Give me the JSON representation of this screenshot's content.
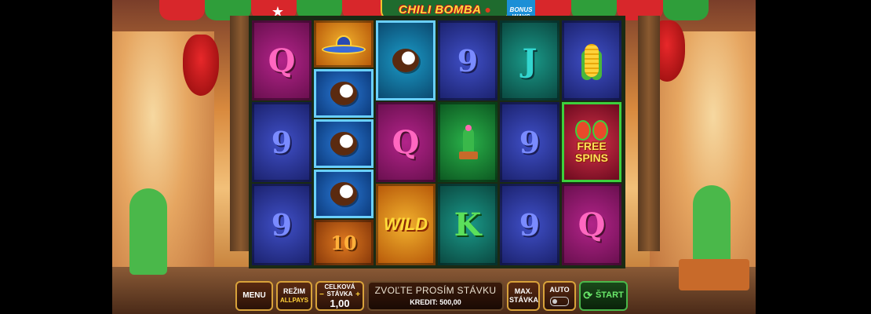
{
  "game": {
    "logo_title": "CHILI BOMBA",
    "logo_tm": "™",
    "bonus_badge": "BONUS\nWAYS"
  },
  "reels": [
    [
      "Q",
      "9",
      "9"
    ],
    [
      "sombrero",
      "coconut",
      "coconut",
      "coconut",
      "10"
    ],
    [
      "coconut",
      "Q",
      "WILD"
    ],
    [
      "9",
      "cactus",
      "K"
    ],
    [
      "J",
      "9",
      "9"
    ],
    [
      "corn",
      "FREE\nSPINS",
      "Q"
    ]
  ],
  "controls": {
    "menu_label": "MENU",
    "mode_label": "REŽIM",
    "mode_value": "ALLPAYS",
    "stake_label": "CELKOVÁ STÁVKA",
    "stake_value": "1,00",
    "stake_minus": "−",
    "stake_plus": "+",
    "message": "ZVOĽTE PROSÍM STÁVKU",
    "credit": "KREDIT: 500,00",
    "max_stake_label": "MAX. STÁVKA",
    "auto_label": "AUTO",
    "start_label": "ŠTART",
    "start_icon": "refresh-icon"
  }
}
